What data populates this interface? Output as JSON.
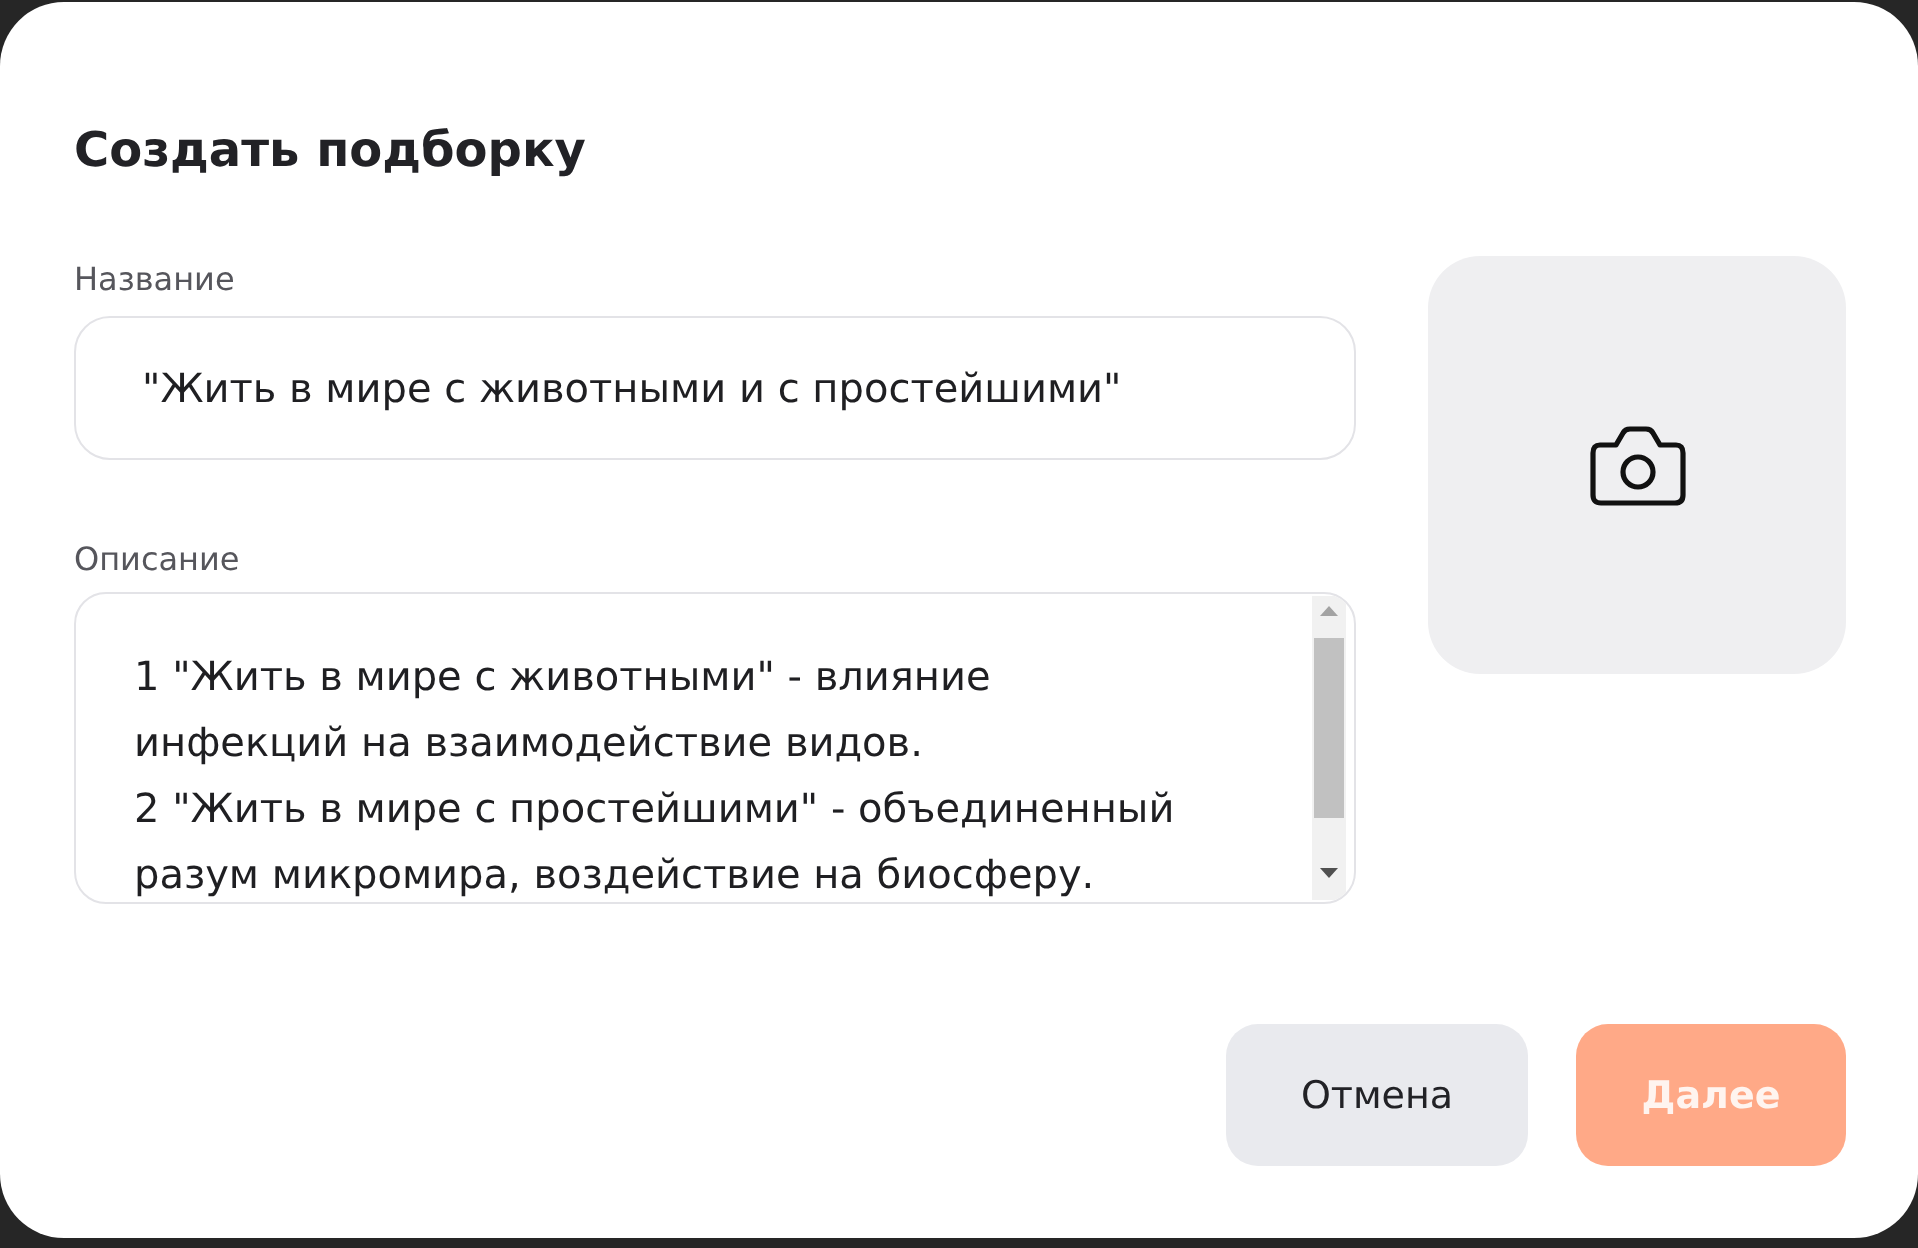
{
  "dialog": {
    "title": "Создать подборку"
  },
  "form": {
    "name_field": {
      "label": "Название",
      "value": "\"Жить в мире с животными и с простейшими\""
    },
    "description_field": {
      "label": "Описание",
      "value": "1 \"Жить в мире с животными\" - влияние\nинфекций на взаимодействие видов.\n2 \"Жить в мире с простейшими\" - объединенный\nразум микромира, воздействие на биосферу."
    }
  },
  "buttons": [
    {
      "label": "Отмена",
      "kind": "secondary",
      "disabled": false
    },
    {
      "label": "Далее",
      "kind": "primary",
      "disabled": true
    }
  ]
}
